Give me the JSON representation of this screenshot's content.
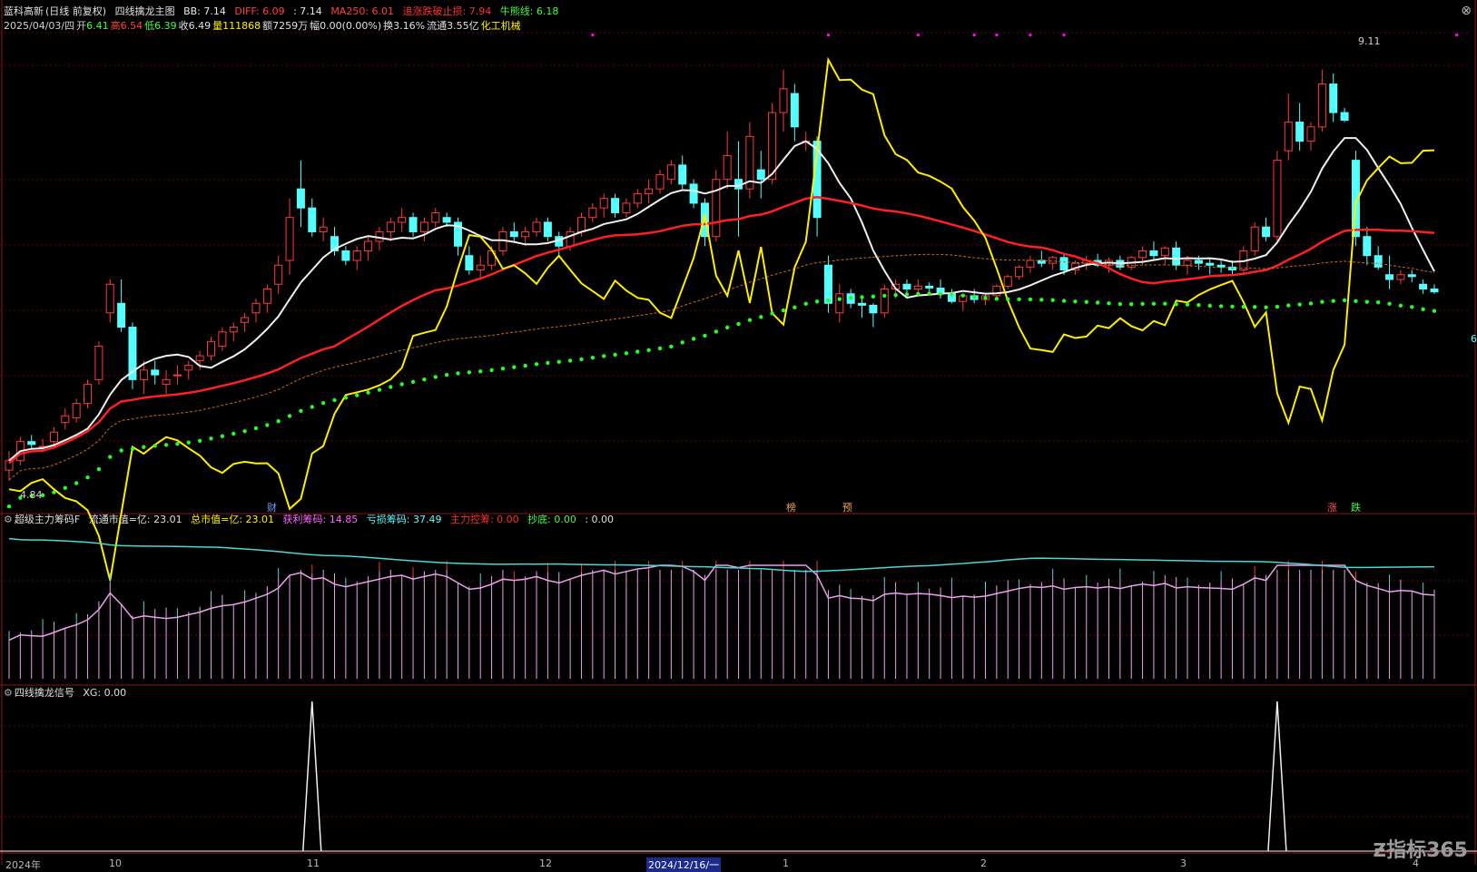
{
  "header": {
    "stock": "蓝科高新",
    "period": "(日线 前复权)",
    "indicator": "四线擒龙主图",
    "bb": "BB: 7.14",
    "diff": "DIFF: 6.09",
    "v3": ": 7.14",
    "ma250": "MA250: 6.01",
    "stop": "追涨跌破止损: 7.94",
    "bull": "牛熊线: 6.18",
    "date": "2025/04/03/四",
    "open_l": "开",
    "open_v": "6.41",
    "high_l": "高",
    "high_v": "6.54",
    "low_l": "低",
    "low_v": "6.39",
    "close": "收6.49",
    "vol_l": "量",
    "vol_v": "111868",
    "amount": "额7259万",
    "change": "幅0.00(0.00%)",
    "turnover": "换3.16%",
    "float": "流通3.55亿",
    "industry": "化工机械"
  },
  "panel2": {
    "title": "超级主力筹码F",
    "float_cap": "流通市值=亿: 23.01",
    "total_cap": "总市值=亿: 23.01",
    "profit": "获利筹码: 14.85",
    "loss": "亏损筹码: 37.49",
    "main": "主力控筹: 0.00",
    "bottom": "抄底: 0.00",
    "blank": ": 0.00"
  },
  "panel3": {
    "title": "四线擒龙信号",
    "xg": "XG: 0.00"
  },
  "price_labels": {
    "low": "4.84",
    "high": "9.11",
    "right": "6"
  },
  "tags": [
    {
      "t": "财",
      "c": "#6a9cff"
    },
    {
      "t": "榜",
      "c": "#e6a15a"
    },
    {
      "t": "预",
      "c": "#e6a15a"
    },
    {
      "t": "涨",
      "c": "#ff5050"
    },
    {
      "t": "跌",
      "c": "#3cff3c"
    }
  ],
  "xaxis": [
    "2024年",
    "10",
    "11",
    "12",
    "2024/12/16/一",
    "1",
    "2",
    "3",
    "4"
  ],
  "logo": "指标365",
  "colors": {
    "up": "#ff3b3b",
    "down": "#54ffff",
    "ma_red": "#ff2020",
    "white": "#f0f0f0",
    "yellow": "#ffee00",
    "green_dots": "#22ff22",
    "magenta": "#ff00ff",
    "pink": "#e7a3e7",
    "cyan": "#4fd6d6"
  },
  "chart_data": {
    "type": "candlestick",
    "candles": [
      [
        4.95,
        5.15,
        4.84,
        5.05
      ],
      [
        5.05,
        5.3,
        5.0,
        5.25
      ],
      [
        5.25,
        5.32,
        5.18,
        5.22
      ],
      [
        5.2,
        5.28,
        5.15,
        5.2
      ],
      [
        5.25,
        5.4,
        5.2,
        5.35
      ],
      [
        5.45,
        5.6,
        5.38,
        5.52
      ],
      [
        5.5,
        5.7,
        5.45,
        5.65
      ],
      [
        5.65,
        5.9,
        5.6,
        5.85
      ],
      [
        5.9,
        6.3,
        5.85,
        6.25
      ],
      [
        6.6,
        6.95,
        6.5,
        6.9
      ],
      [
        6.7,
        6.95,
        6.4,
        6.45
      ],
      [
        6.45,
        6.5,
        5.8,
        5.9
      ],
      [
        5.9,
        6.1,
        5.75,
        6.0
      ],
      [
        6.0,
        6.1,
        5.85,
        5.95
      ],
      [
        5.85,
        6.0,
        5.75,
        5.9
      ],
      [
        5.95,
        6.05,
        5.85,
        5.95
      ],
      [
        6.0,
        6.1,
        5.9,
        6.05
      ],
      [
        6.1,
        6.2,
        6.0,
        6.15
      ],
      [
        6.15,
        6.35,
        6.1,
        6.3
      ],
      [
        6.25,
        6.45,
        6.2,
        6.4
      ],
      [
        6.4,
        6.5,
        6.3,
        6.45
      ],
      [
        6.5,
        6.6,
        6.4,
        6.55
      ],
      [
        6.6,
        6.75,
        6.5,
        6.7
      ],
      [
        6.7,
        6.9,
        6.6,
        6.85
      ],
      [
        6.9,
        7.2,
        6.8,
        7.1
      ],
      [
        7.15,
        7.8,
        7.0,
        7.6
      ],
      [
        7.9,
        8.2,
        7.5,
        7.7
      ],
      [
        7.7,
        7.8,
        7.4,
        7.45
      ],
      [
        7.45,
        7.6,
        7.35,
        7.5
      ],
      [
        7.4,
        7.5,
        7.2,
        7.25
      ],
      [
        7.25,
        7.3,
        7.1,
        7.15
      ],
      [
        7.15,
        7.3,
        7.05,
        7.25
      ],
      [
        7.25,
        7.4,
        7.15,
        7.35
      ],
      [
        7.35,
        7.5,
        7.25,
        7.45
      ],
      [
        7.45,
        7.6,
        7.35,
        7.55
      ],
      [
        7.55,
        7.7,
        7.45,
        7.6
      ],
      [
        7.6,
        7.65,
        7.4,
        7.45
      ],
      [
        7.45,
        7.6,
        7.35,
        7.55
      ],
      [
        7.55,
        7.7,
        7.5,
        7.65
      ],
      [
        7.6,
        7.65,
        7.5,
        7.55
      ],
      [
        7.55,
        7.6,
        7.2,
        7.3
      ],
      [
        7.2,
        7.3,
        7.0,
        7.05
      ],
      [
        7.05,
        7.2,
        6.95,
        7.1
      ],
      [
        7.1,
        7.3,
        7.05,
        7.25
      ],
      [
        7.25,
        7.5,
        7.2,
        7.45
      ],
      [
        7.45,
        7.55,
        7.35,
        7.4
      ],
      [
        7.4,
        7.5,
        7.3,
        7.45
      ],
      [
        7.45,
        7.6,
        7.4,
        7.55
      ],
      [
        7.55,
        7.6,
        7.35,
        7.4
      ],
      [
        7.4,
        7.45,
        7.2,
        7.3
      ],
      [
        7.3,
        7.5,
        7.25,
        7.45
      ],
      [
        7.45,
        7.65,
        7.4,
        7.6
      ],
      [
        7.6,
        7.75,
        7.55,
        7.7
      ],
      [
        7.7,
        7.85,
        7.6,
        7.8
      ],
      [
        7.8,
        7.85,
        7.6,
        7.65
      ],
      [
        7.65,
        7.8,
        7.6,
        7.75
      ],
      [
        7.75,
        7.9,
        7.7,
        7.85
      ],
      [
        7.85,
        8.0,
        7.75,
        7.9
      ],
      [
        7.9,
        8.1,
        7.85,
        8.05
      ],
      [
        8.0,
        8.2,
        7.95,
        8.15
      ],
      [
        8.15,
        8.25,
        7.9,
        7.95
      ],
      [
        7.95,
        8.0,
        7.7,
        7.75
      ],
      [
        7.75,
        7.8,
        7.3,
        7.4
      ],
      [
        7.4,
        8.1,
        7.35,
        8.0
      ],
      [
        8.0,
        8.5,
        7.9,
        8.25
      ],
      [
        8.0,
        8.4,
        7.4,
        7.9
      ],
      [
        7.9,
        8.6,
        7.8,
        8.45
      ],
      [
        8.1,
        8.3,
        7.8,
        8.0
      ],
      [
        8.0,
        8.8,
        7.95,
        8.7
      ],
      [
        8.7,
        9.15,
        8.5,
        8.95
      ],
      [
        8.9,
        9.0,
        8.4,
        8.55
      ],
      [
        8.4,
        8.5,
        8.3,
        8.4
      ],
      [
        8.4,
        8.45,
        7.4,
        7.6
      ],
      [
        7.1,
        7.2,
        6.6,
        6.7
      ],
      [
        6.6,
        6.9,
        6.5,
        6.8
      ],
      [
        6.8,
        6.85,
        6.65,
        6.7
      ],
      [
        6.7,
        6.75,
        6.55,
        6.68
      ],
      [
        6.68,
        6.7,
        6.45,
        6.6
      ],
      [
        6.6,
        6.9,
        6.55,
        6.85
      ],
      [
        6.85,
        6.95,
        6.75,
        6.9
      ],
      [
        6.9,
        6.95,
        6.8,
        6.85
      ],
      [
        6.85,
        6.95,
        6.8,
        6.88
      ],
      [
        6.88,
        6.92,
        6.8,
        6.86
      ],
      [
        6.86,
        6.95,
        6.75,
        6.8
      ],
      [
        6.8,
        6.85,
        6.7,
        6.72
      ],
      [
        6.72,
        6.8,
        6.62,
        6.78
      ],
      [
        6.78,
        6.85,
        6.7,
        6.74
      ],
      [
        6.74,
        6.8,
        6.68,
        6.78
      ],
      [
        6.78,
        6.9,
        6.75,
        6.88
      ],
      [
        6.88,
        7.0,
        6.85,
        6.98
      ],
      [
        6.98,
        7.1,
        6.95,
        7.08
      ],
      [
        7.08,
        7.2,
        7.02,
        7.15
      ],
      [
        7.15,
        7.25,
        7.08,
        7.12
      ],
      [
        7.12,
        7.2,
        7.05,
        7.18
      ],
      [
        7.18,
        7.22,
        7.0,
        7.05
      ],
      [
        7.05,
        7.15,
        7.0,
        7.12
      ],
      [
        7.12,
        7.2,
        7.05,
        7.15
      ],
      [
        7.15,
        7.22,
        7.08,
        7.1
      ],
      [
        7.1,
        7.18,
        7.02,
        7.15
      ],
      [
        7.15,
        7.2,
        7.05,
        7.08
      ],
      [
        7.08,
        7.2,
        7.05,
        7.18
      ],
      [
        7.18,
        7.3,
        7.1,
        7.25
      ],
      [
        7.25,
        7.35,
        7.15,
        7.2
      ],
      [
        7.2,
        7.3,
        7.1,
        7.28
      ],
      [
        7.28,
        7.35,
        7.05,
        7.1
      ],
      [
        7.1,
        7.2,
        7.0,
        7.15
      ],
      [
        7.15,
        7.2,
        7.05,
        7.12
      ],
      [
        7.12,
        7.18,
        7.0,
        7.1
      ],
      [
        7.1,
        7.15,
        7.02,
        7.08
      ],
      [
        7.08,
        7.15,
        7.0,
        7.05
      ],
      [
        7.05,
        7.3,
        7.02,
        7.25
      ],
      [
        7.25,
        7.55,
        7.2,
        7.5
      ],
      [
        7.5,
        7.6,
        7.35,
        7.4
      ],
      [
        7.4,
        8.3,
        7.35,
        8.2
      ],
      [
        8.3,
        8.9,
        8.2,
        8.6
      ],
      [
        8.6,
        8.8,
        8.3,
        8.4
      ],
      [
        8.4,
        8.6,
        8.3,
        8.55
      ],
      [
        8.55,
        9.15,
        8.5,
        9.0
      ],
      [
        9.0,
        9.11,
        8.6,
        8.7
      ],
      [
        8.7,
        8.75,
        8.6,
        8.62
      ],
      [
        8.2,
        8.3,
        7.3,
        7.4
      ],
      [
        7.4,
        7.5,
        7.1,
        7.2
      ],
      [
        7.2,
        7.3,
        7.05,
        7.08
      ],
      [
        7.0,
        7.2,
        6.85,
        6.95
      ],
      [
        6.95,
        7.05,
        6.9,
        7.0
      ],
      [
        7.0,
        7.05,
        6.92,
        6.98
      ],
      [
        6.9,
        6.95,
        6.8,
        6.85
      ],
      [
        6.85,
        6.9,
        6.8,
        6.82
      ]
    ]
  }
}
